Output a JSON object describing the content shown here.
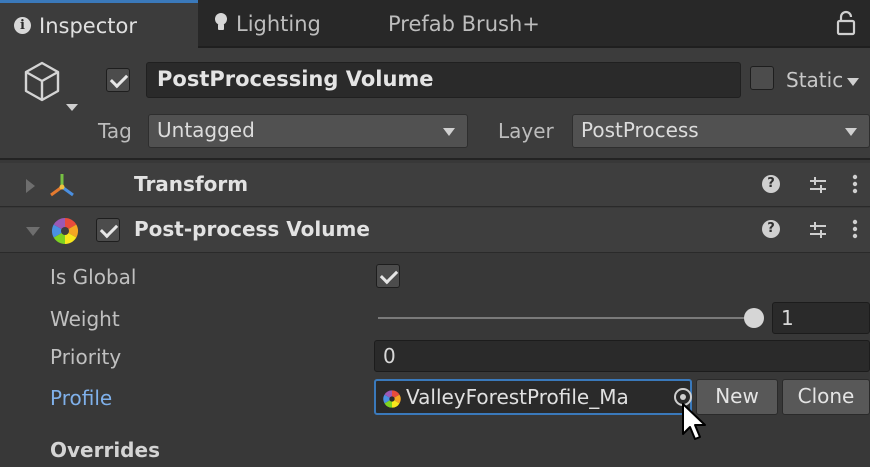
{
  "tabs": [
    {
      "label": "Inspector",
      "icon": "info-icon",
      "active": true
    },
    {
      "label": "Lighting",
      "icon": "lightbulb-icon",
      "active": false
    },
    {
      "label": "Prefab Brush+",
      "icon": "",
      "active": false
    }
  ],
  "gameobject": {
    "active": true,
    "name": "PostProcessing Volume",
    "static_label": "Static",
    "static": false,
    "tag_label": "Tag",
    "tag_value": "Untagged",
    "layer_label": "Layer",
    "layer_value": "PostProcess"
  },
  "components": {
    "transform": {
      "title": "Transform",
      "expanded": false
    },
    "volume": {
      "title": "Post-process Volume",
      "expanded": true,
      "enabled": true,
      "is_global_label": "Is Global",
      "is_global": true,
      "weight_label": "Weight",
      "weight_value": "1",
      "weight_fraction": 1.0,
      "priority_label": "Priority",
      "priority_value": "0",
      "profile_label": "Profile",
      "profile_value": "ValleyForestProfile_Ma",
      "new_label": "New",
      "clone_label": "Clone",
      "overrides_label": "Overrides"
    }
  },
  "colors": {
    "accent": "#3a79bb",
    "profile_label": "#7fb0ea",
    "background": "#383838"
  }
}
